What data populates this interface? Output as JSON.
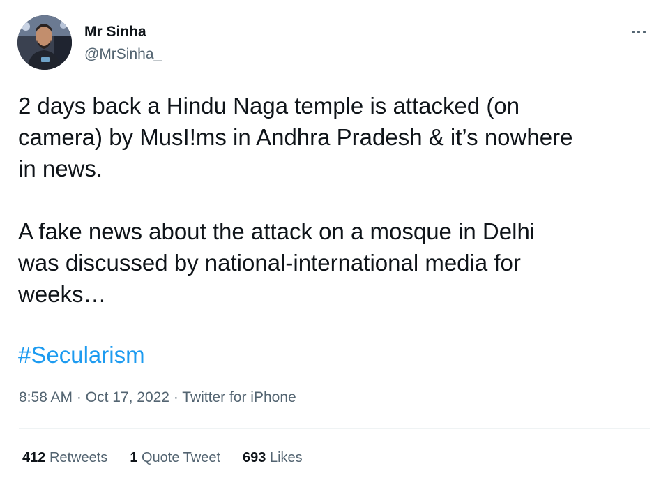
{
  "author": {
    "display_name": "Mr Sinha",
    "handle": "@MrSinha_",
    "avatar_icon": "user-avatar-photo"
  },
  "more_icon": "ellipsis-icon",
  "tweet": {
    "text": "2 days back a Hindu Naga temple is attacked (on\ncamera) by MusI!ms in Andhra Pradesh & it’s nowhere\nin news.\n\nA fake news about the attack on a mosque in Delhi\nwas discussed by national-international media for\nweeks…",
    "hashtag": "#Secularism",
    "time": "8:58 AM",
    "date": "Oct 17, 2022",
    "source": "Twitter for iPhone",
    "separator": " · "
  },
  "stats": {
    "retweets": {
      "count": "412",
      "label": "Retweets"
    },
    "quotes": {
      "count": "1",
      "label": "Quote Tweet"
    },
    "likes": {
      "count": "693",
      "label": "Likes"
    }
  },
  "colors": {
    "text": "#0f1419",
    "secondary": "#536471",
    "link": "#1d9bf0",
    "divider": "#eff3f4"
  }
}
